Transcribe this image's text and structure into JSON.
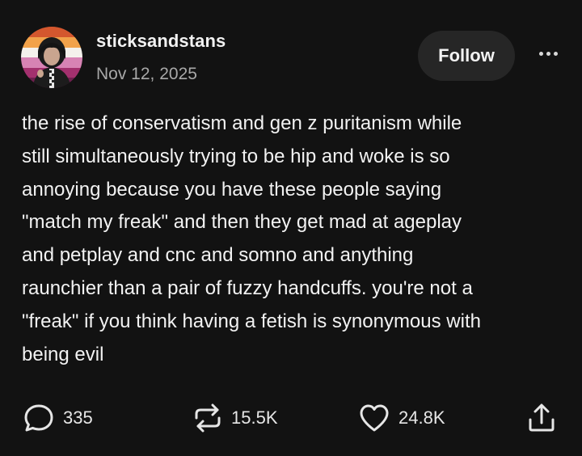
{
  "post": {
    "author": {
      "username": "sticksandstans",
      "avatar_icon": "profile-avatar"
    },
    "date": "Nov 12, 2025",
    "follow_label": "Follow",
    "more_icon": "more-dots-icon",
    "body_lines": [
      "the rise of conservatism and gen z puritanism while",
      "still simultaneously trying to be hip and woke is so",
      "annoying because you have these people saying",
      "\"match my freak\" and then they get mad at ageplay",
      "and petplay and cnc and somno and anything",
      "raunchier than a pair of fuzzy handcuffs. you're not a",
      "\"freak\" if you think having a fetish is synonymous with",
      "being evil"
    ],
    "actions": {
      "comments": {
        "icon": "comment-bubble-icon",
        "count": "335"
      },
      "reblogs": {
        "icon": "repost-icon",
        "count": "15.5K"
      },
      "likes": {
        "icon": "heart-icon",
        "count": "24.8K"
      },
      "share": {
        "icon": "share-icon"
      }
    }
  },
  "colors": {
    "background": "#121212",
    "text": "#f2f2f2",
    "muted": "#a8a8a8",
    "button_bg": "#262626"
  }
}
